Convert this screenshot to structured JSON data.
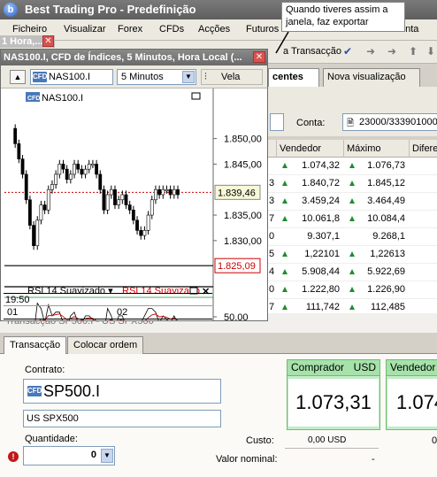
{
  "app": {
    "logo_letter": "b",
    "title": "Best Trading Pro - Predefinição"
  },
  "menu": [
    "Ficheiro",
    "Visualizar",
    "Forex",
    "CFDs",
    "Acções",
    "Futuros",
    "onta"
  ],
  "callout_text": "Quando tiveres assim a janela, faz exportar",
  "toolbar": {
    "transaction_label": "a Transacção"
  },
  "mini_window": {
    "title": "1 Hora,..."
  },
  "chart_window": {
    "title": "NAS100.I, CFD de Índices, 5 Minutos, Hora Local (...",
    "cfd_badge": "CFD",
    "symbol": "NAS100.I",
    "interval": "5 Minutos",
    "style": "Vela",
    "legend_symbol": "NAS100.I",
    "price_labels": [
      "1.850,00",
      "1.845,00",
      "1.839,46",
      "1.835,00",
      "1.830,00",
      "1.825,09"
    ],
    "indicator_label": "RSI 14 Suavizado ▾",
    "indicator_label_red": "RSI 14 Suavizado",
    "indicator_axis": "50,00",
    "time_labels": [
      "19:50",
      "01",
      "02"
    ]
  },
  "chart_data": {
    "type": "candlestick",
    "title": "NAS100.I, CFD de Índices, 5 Minutos, Hora Local",
    "ylim": [
      1822,
      1856
    ],
    "yticks": [
      1850,
      1845,
      1835,
      1830
    ],
    "current_price": 1839.46,
    "low_marker": 1825.09,
    "close_series": [
      1852,
      1849,
      1846,
      1843,
      1838,
      1833,
      1829,
      1834,
      1837,
      1836,
      1840,
      1841,
      1843,
      1845,
      1844,
      1842,
      1843,
      1845,
      1844,
      1843,
      1844,
      1845,
      1845,
      1843,
      1840,
      1836,
      1839,
      1840,
      1837,
      1838,
      1839,
      1837,
      1836,
      1834,
      1832,
      1831,
      1832,
      1835,
      1838,
      1840,
      1839,
      1840,
      1840,
      1839,
      1840,
      1839
    ],
    "indicator": {
      "name": "RSI 14 Suavizado",
      "axis_tick": 50
    }
  },
  "right_panel": {
    "tabs": [
      "centes",
      "Nova visualização"
    ],
    "account_label": "Conta:",
    "account_value": "23000/333901000",
    "columns": [
      "Vendedor",
      "Máximo",
      "Difere"
    ],
    "rows": [
      {
        "lead": "",
        "seller": "1.074,32",
        "max": "1.076,73",
        "arrow": true
      },
      {
        "lead": "3",
        "seller": "1.840,72",
        "max": "1.845,12",
        "arrow": true
      },
      {
        "lead": "3",
        "seller": "3.459,24",
        "max": "3.464,49",
        "arrow": true
      },
      {
        "lead": "7",
        "seller": "10.061,8",
        "max": "10.084,4",
        "arrow": true
      },
      {
        "lead": "0",
        "seller": "9.307,1",
        "max": "9.268,1",
        "arrow": false
      },
      {
        "lead": "5",
        "seller": "1,22101",
        "max": "1,22613",
        "arrow": true
      },
      {
        "lead": "4",
        "seller": "5.908,44",
        "max": "5.922,69",
        "arrow": true
      },
      {
        "lead": "0",
        "seller": "1.222,80",
        "max": "1.226,90",
        "arrow": true
      },
      {
        "lead": "7",
        "seller": "111,742",
        "max": "112,485",
        "arrow": true
      }
    ]
  },
  "transaction": {
    "header": "Transacção SP500.I - US SPX500",
    "tabs": [
      "Transacção",
      "Colocar ordem"
    ],
    "contract_label": "Contrato:",
    "contract_badge": "CFD",
    "contract_symbol": "SP500.I",
    "contract_desc": "US SPX500",
    "quantity_label": "Quantidade:",
    "quantity_value": "0",
    "cost_label": "Custo:",
    "cost_value": "0,00 USD",
    "nominal_label": "Valor nominal:",
    "nominal_value": "-",
    "buyer_label": "Comprador",
    "buyer_currency": "USD",
    "buyer_price": "1.073,31",
    "seller_label": "Vendedor",
    "seller_price_partial": "1.074",
    "seller_cost": "0,"
  },
  "colors": {
    "buy_green": "#c5eec8",
    "up_arrow": "#1e8d2f",
    "price_red": "#cc0000"
  }
}
